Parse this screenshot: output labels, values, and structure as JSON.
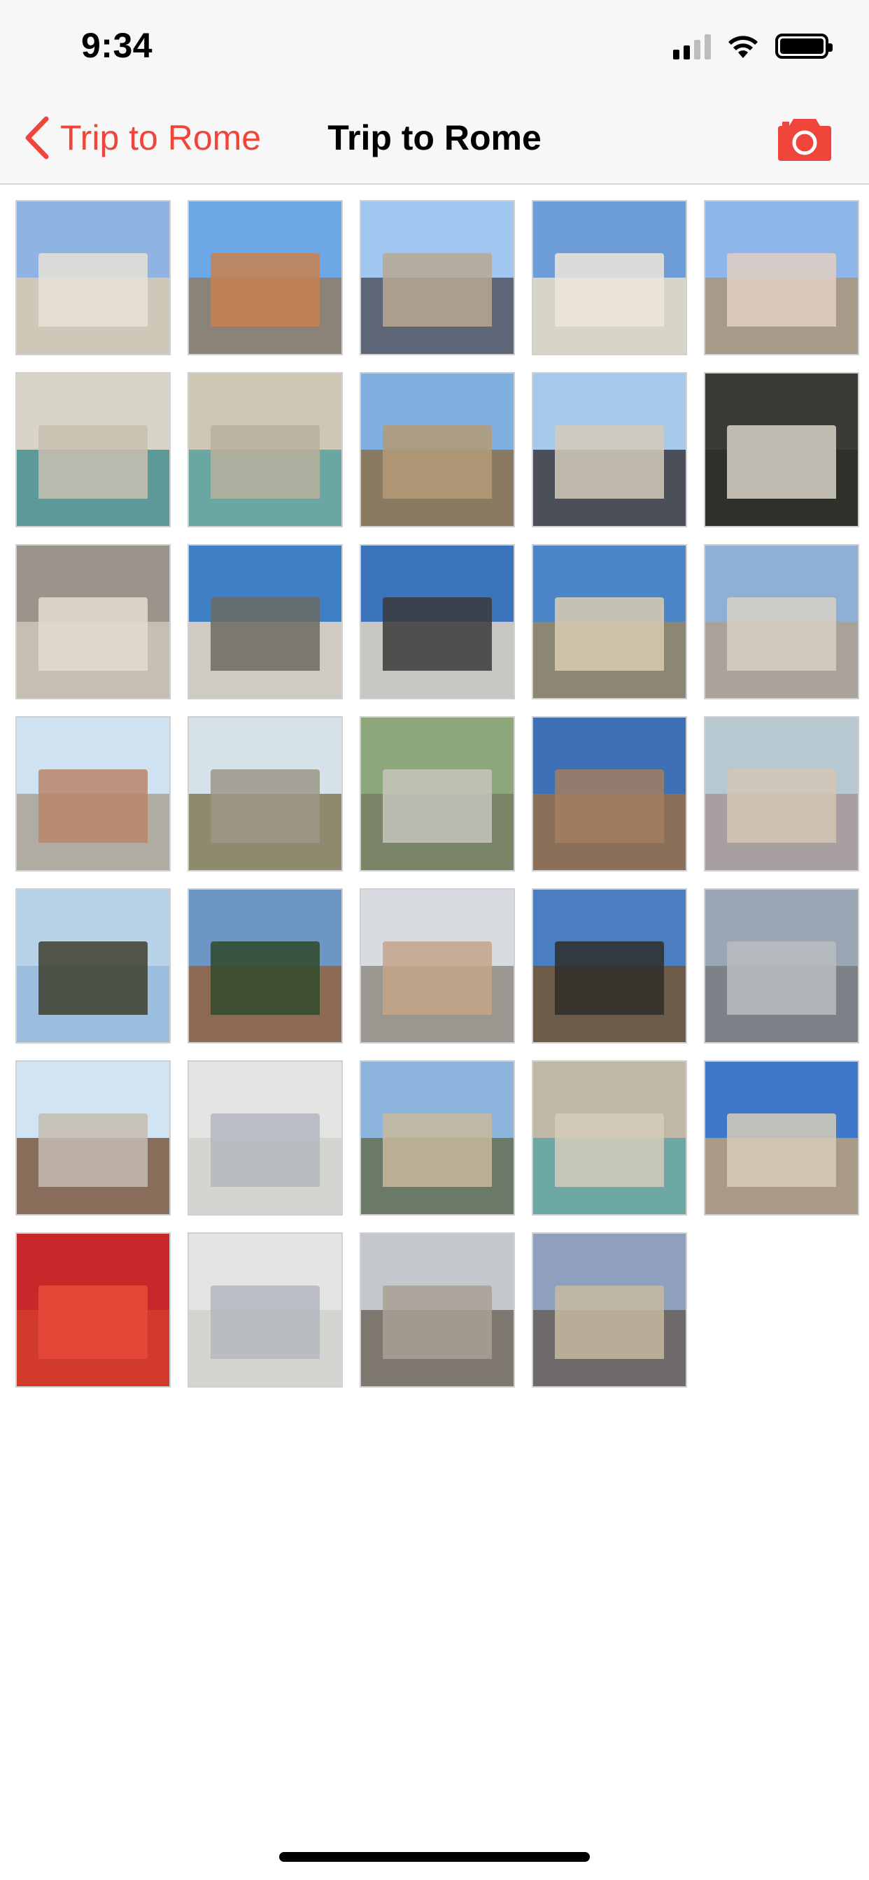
{
  "status_bar": {
    "time": "9:34"
  },
  "nav": {
    "back_label": "Trip to Rome",
    "title": "Trip to Rome",
    "accent_color": "#f0453a",
    "back_icon": "chevron-left-icon",
    "camera_icon": "camera-icon"
  },
  "photos": [
    {
      "desc": "building-facade",
      "sky": "#8fb4e3",
      "ground": "#cfc7b8",
      "subject": "#e8e2d6"
    },
    {
      "desc": "orange-building-street",
      "sky": "#6ea7e6",
      "ground": "#8a8378",
      "subject": "#c9824e"
    },
    {
      "desc": "narrow-street",
      "sky": "#9fc7ef",
      "ground": "#5c6676",
      "subject": "#b8a892"
    },
    {
      "desc": "church-steps",
      "sky": "#6d9ed8",
      "ground": "#d9d4c8",
      "subject": "#ece6da"
    },
    {
      "desc": "spanish-steps",
      "sky": "#8eb6e8",
      "ground": "#a89a88",
      "subject": "#e2d0c4"
    },
    {
      "desc": "trevi-fountain",
      "sky": "#d8d4c8",
      "ground": "#5c9a9a",
      "subject": "#c8c0b0"
    },
    {
      "desc": "trevi-fountain-close",
      "sky": "#cfc7b6",
      "ground": "#6aa6a2",
      "subject": "#b9b09e"
    },
    {
      "desc": "ancient-columns",
      "sky": "#7fb0df",
      "ground": "#8a7a62",
      "subject": "#b49a78"
    },
    {
      "desc": "pantheon",
      "sky": "#a6c8ea",
      "ground": "#4b4f5a",
      "subject": "#d2cabc"
    },
    {
      "desc": "information-sign",
      "sky": "#3a3a36",
      "ground": "#2e302c",
      "subject": "#d8d4c8"
    },
    {
      "desc": "marble-sculpture",
      "sky": "#9a948a",
      "ground": "#c6beb0",
      "subject": "#e4dcd0"
    },
    {
      "desc": "equestrian-statue",
      "sky": "#3f7fc6",
      "ground": "#d0cbc0",
      "subject": "#6d6a62"
    },
    {
      "desc": "rooftop-statues",
      "sky": "#3c74bc",
      "ground": "#c8c6c2",
      "subject": "#3a3a3a"
    },
    {
      "desc": "st-peters-basilica",
      "sky": "#4d86c8",
      "ground": "#8c8674",
      "subject": "#d8ccb0"
    },
    {
      "desc": "st-peters-from-street",
      "sky": "#8fb0d4",
      "ground": "#a8a29a",
      "subject": "#d8d0c2"
    },
    {
      "desc": "castel-sant-angelo",
      "sky": "#cfe2f2",
      "ground": "#b0aca4",
      "subject": "#b8866a"
    },
    {
      "desc": "tiber-bridge",
      "sky": "#d6e2ea",
      "ground": "#8e8a6e",
      "subject": "#9c968a"
    },
    {
      "desc": "stone-bridge-arches",
      "sky": "#8da67a",
      "ground": "#7a8466",
      "subject": "#c8c4bc"
    },
    {
      "desc": "castle-wall",
      "sky": "#3d70b4",
      "ground": "#8a7058",
      "subject": "#a07e62"
    },
    {
      "desc": "bridge-crowd",
      "sky": "#b8c8d0",
      "ground": "#a8a0a0",
      "subject": "#d4c6b6"
    },
    {
      "desc": "tree-branches",
      "sky": "#b8d2ea",
      "ground": "#9cbede",
      "subject": "#3e3e2e"
    },
    {
      "desc": "seagull-on-roof",
      "sky": "#6e96c4",
      "ground": "#8c6a54",
      "subject": "#2f4a2a"
    },
    {
      "desc": "city-wall-path",
      "sky": "#d8dce0",
      "ground": "#9a9690",
      "subject": "#c4a48a"
    },
    {
      "desc": "angel-statue",
      "sky": "#4a7ec0",
      "ground": "#6e5a48",
      "subject": "#2e2e2a"
    },
    {
      "desc": "vittoriano-haze",
      "sky": "#9aa6b4",
      "ground": "#7e8288",
      "subject": "#b8bcc0"
    },
    {
      "desc": "trajan-column",
      "sky": "#d0e4f4",
      "ground": "#8a6e5c",
      "subject": "#c4bcb0"
    },
    {
      "desc": "metro-map",
      "sky": "#e4e4e2",
      "ground": "#d4d4d0",
      "subject": "#b4b8c0"
    },
    {
      "desc": "river-view",
      "sky": "#8cb4dc",
      "ground": "#6a7a66",
      "subject": "#c8b89c"
    },
    {
      "desc": "trevi-fountain-pool",
      "sky": "#c0b8a6",
      "ground": "#6ea8a4",
      "subject": "#d4ccbc"
    },
    {
      "desc": "obelisk-piazza",
      "sky": "#3f78c8",
      "ground": "#a89a86",
      "subject": "#d6ccb8"
    },
    {
      "desc": "tomato-crate",
      "sky": "#c8282a",
      "ground": "#d23a2c",
      "subject": "#e84a3a"
    },
    {
      "desc": "metro-map-2",
      "sky": "#e4e4e2",
      "ground": "#d4d4d0",
      "subject": "#b4b8c0"
    },
    {
      "desc": "piazza-del-popolo-evening",
      "sky": "#c4c8cc",
      "ground": "#7e7870",
      "subject": "#a8a094"
    },
    {
      "desc": "twin-churches-dusk",
      "sky": "#8ea0be",
      "ground": "#6e6a6a",
      "subject": "#c8b8a0"
    }
  ]
}
